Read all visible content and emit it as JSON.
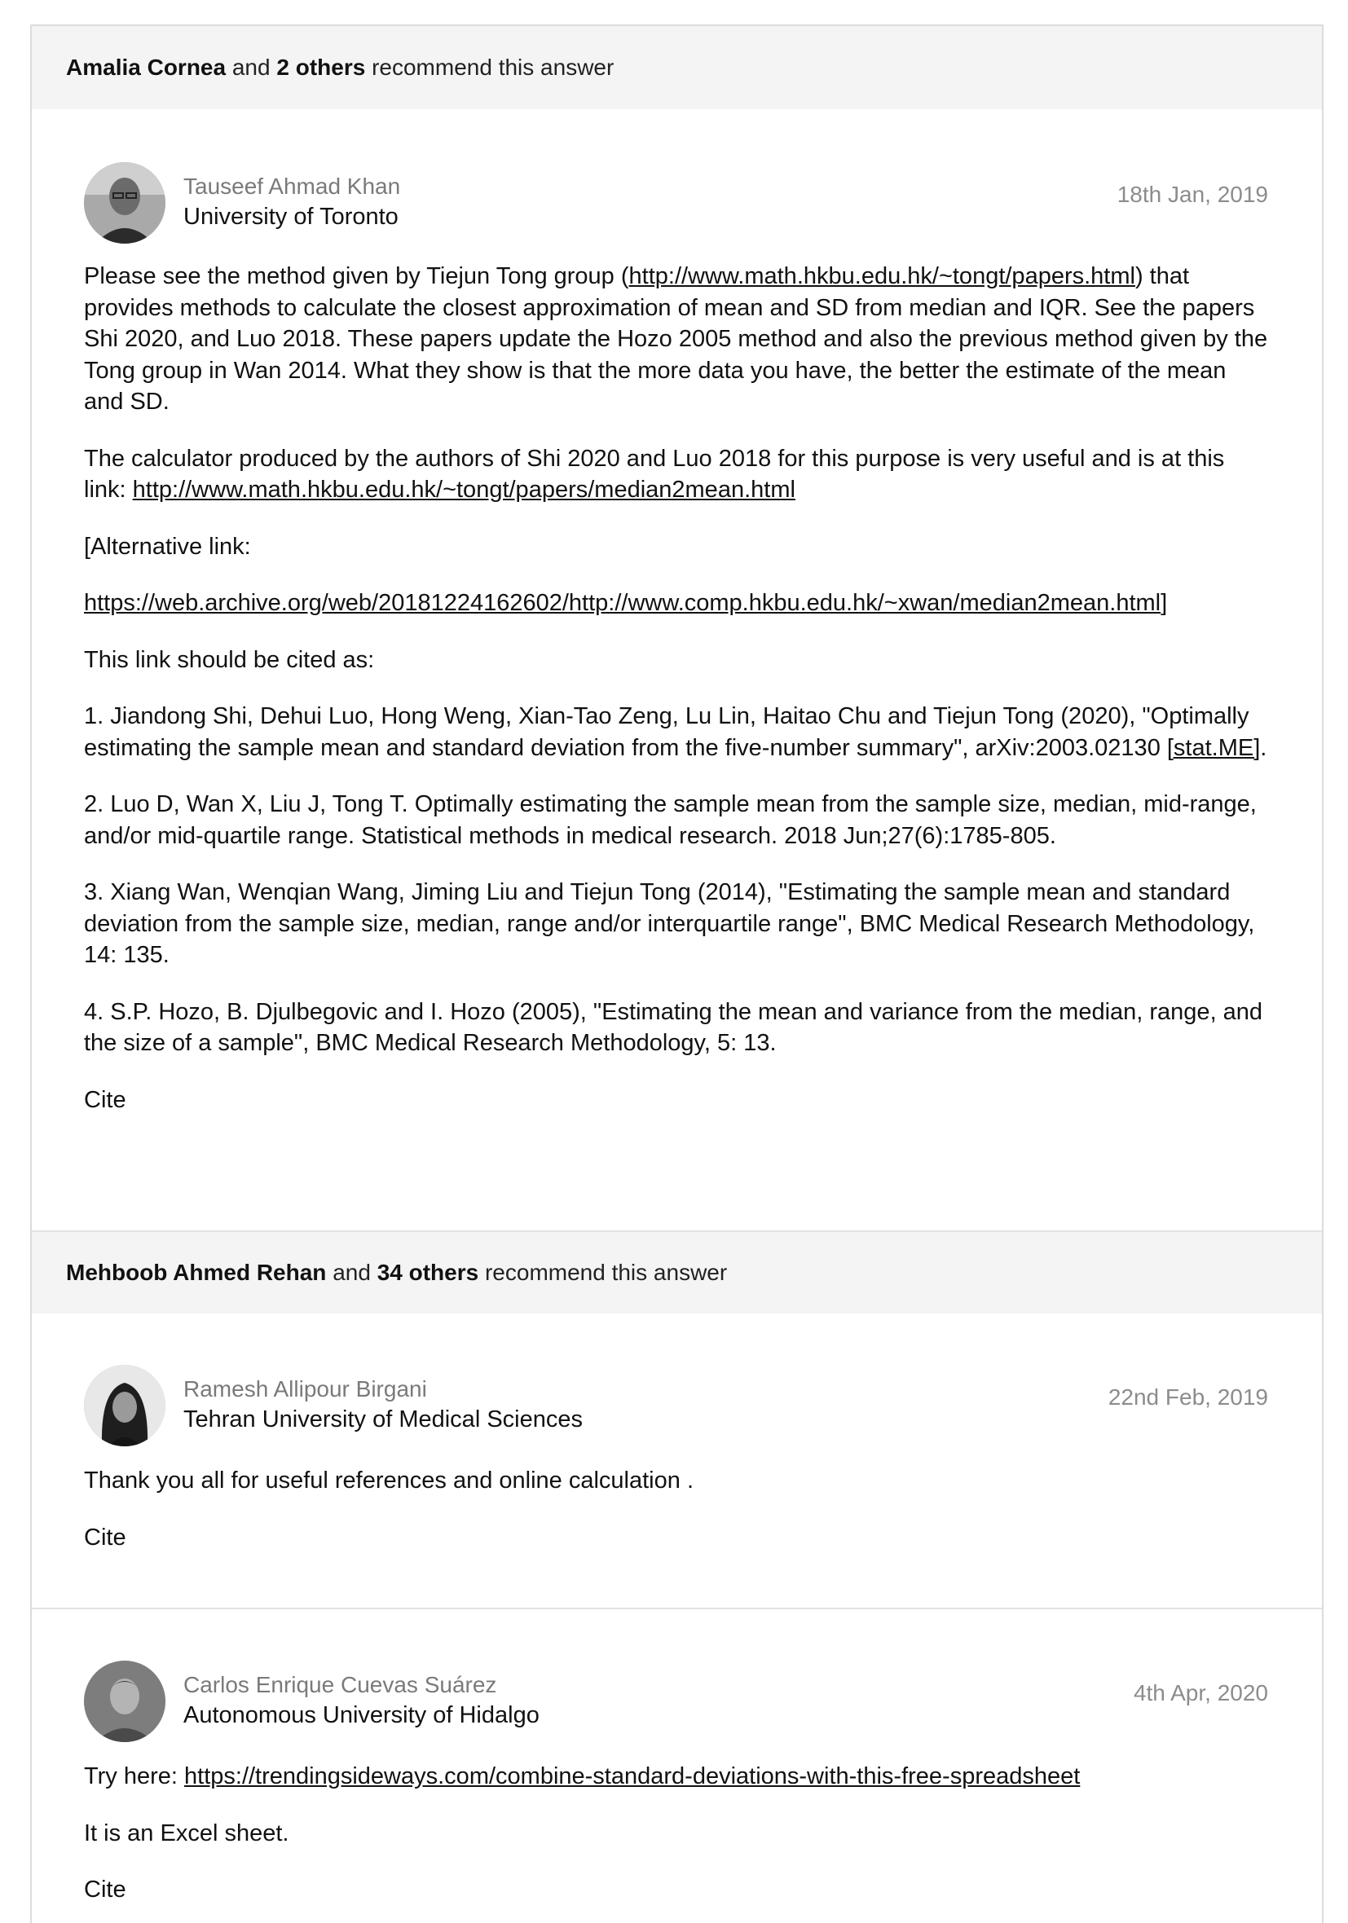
{
  "answers": [
    {
      "recommend": {
        "name": "Amalia Cornea",
        "and": "and",
        "count": "2 others",
        "suffix": "recommend this answer"
      },
      "author": {
        "name": "Tauseef Ahmad Khan",
        "institution": "University of Toronto"
      },
      "date": "18th Jan, 2019",
      "p1": {
        "before": "Please see the method given by Tiejun Tong group (",
        "link": "http://www.math.hkbu.edu.hk/~tongt/papers.html",
        "after": ") that provides methods to calculate the closest approximation of mean and SD from median and IQR. See the papers Shi 2020, and Luo 2018. These papers update the Hozo 2005 method and also the previous method given by the Tong group in Wan 2014. What they show is that the more data you have, the better the estimate of the mean and SD."
      },
      "p2": {
        "before": "The calculator produced by the authors of Shi 2020 and Luo 2018 for this purpose is very useful and is at this link: ",
        "link": "http://www.math.hkbu.edu.hk/~tongt/papers/median2mean.html"
      },
      "p3": "[Alternative link:",
      "p4": {
        "link": "https://web.archive.org/web/20181224162602/http://www.comp.hkbu.edu.hk/~xwan/median2mean.html",
        "after": "]"
      },
      "p5": "This link should be cited as:",
      "ref1": {
        "before": "1. Jiandong Shi, Dehui Luo, Hong Weng, Xian-Tao Zeng, Lu Lin, Haitao Chu and Tiejun Tong (2020), \"Optimally estimating the sample mean and standard deviation from the five-number summary\", arXiv:2003.02130 ",
        "link": "[stat.ME]",
        "after": "."
      },
      "ref2": "2. Luo D, Wan X, Liu J, Tong T. Optimally estimating the sample mean from the sample size, median, mid-range, and/or mid-quartile range. Statistical methods in medical research. 2018 Jun;27(6):1785-805.",
      "ref3": "3. Xiang Wan, Wenqian Wang, Jiming Liu and Tiejun Tong (2014), \"Estimating the sample mean and standard deviation from the sample size, median, range and/or interquartile range\", BMC Medical Research Methodology, 14: 135.",
      "ref4": "4. S.P. Hozo, B. Djulbegovic and I. Hozo (2005), \"Estimating the mean and variance from the median, range, and the size of a sample\", BMC Medical Research Methodology, 5: 13.",
      "cite": "Cite"
    },
    {
      "recommend": {
        "name": "Mehboob Ahmed Rehan",
        "and": "and",
        "count": "34 others",
        "suffix": "recommend this answer"
      },
      "author": {
        "name": "Ramesh Allipour Birgani",
        "institution": "Tehran University of Medical Sciences"
      },
      "date": "22nd Feb, 2019",
      "p1": "Thank you all for useful references and online calculation .",
      "cite": "Cite"
    },
    {
      "author": {
        "name": "Carlos Enrique Cuevas Suárez",
        "institution": "Autonomous University of Hidalgo"
      },
      "date": "4th Apr, 2020",
      "p1": {
        "before": "Try here: ",
        "link": "https://trendingsideways.com/combine-standard-deviations-with-this-free-spreadsheet"
      },
      "p2": "It is an Excel sheet.",
      "cite": "Cite"
    }
  ]
}
